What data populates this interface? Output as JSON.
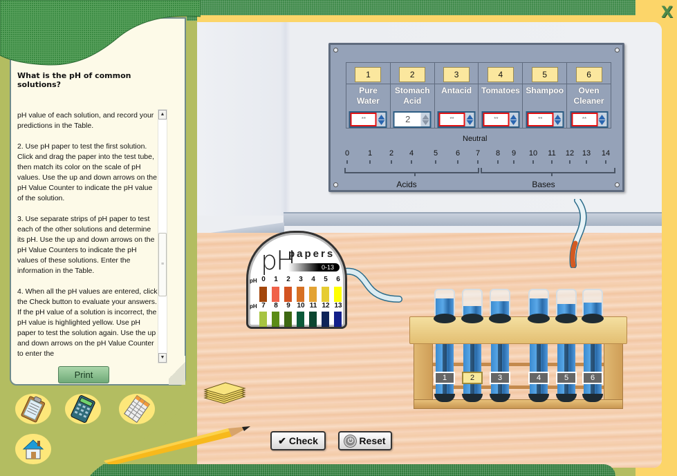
{
  "window": {
    "close_label": "X"
  },
  "left_panel": {
    "title": "What is the pH of common solutions?",
    "instructions": [
      "pH value of each solution, and record your predictions in the Table.",
      "2. Use pH paper to test the first solution. Click and drag the paper into the test tube, then match its color on the scale of pH values. Use the up and down arrows on the pH Value Counter to indicate the pH value of the solution.",
      "3. Use separate strips of pH paper to test each of the other solutions and determine its pH. Use the up and down arrows on the pH Value Counters to indicate the pH values of these solutions. Enter the information in the Table.",
      "4. When all the pH values are entered, click the Check button to evaluate your answers. If the pH value of a solution is incorrect, the pH value is highlighted yellow. Use pH paper to test the solution again. Use the up and down arrows on the pH Value Counter to enter the"
    ],
    "scroll_up_glyph": "▲",
    "scroll_down_glyph": "▼",
    "scroll_thumb_glyph": "≡",
    "print_label": "Print"
  },
  "tools": [
    {
      "name": "clipboard-icon",
      "label": "Clipboard"
    },
    {
      "name": "calculator-icon",
      "label": "Calculator"
    },
    {
      "name": "table-icon",
      "label": "Table"
    },
    {
      "name": "home-icon",
      "label": "Home"
    }
  ],
  "ph_panel": {
    "solutions": [
      {
        "number": "1",
        "name_line1": "Pure",
        "name_line2": "Water",
        "value": "**",
        "filled": false
      },
      {
        "number": "2",
        "name_line1": "Stomach",
        "name_line2": "Acid",
        "value": "2",
        "filled": true
      },
      {
        "number": "3",
        "name_line1": "Antacid",
        "name_line2": "",
        "value": "**",
        "filled": false
      },
      {
        "number": "4",
        "name_line1": "Tomatoes",
        "name_line2": "",
        "value": "**",
        "filled": false
      },
      {
        "number": "5",
        "name_line1": "Shampoo",
        "name_line2": "",
        "value": "**",
        "filled": false
      },
      {
        "number": "6",
        "name_line1": "Oven",
        "name_line2": "Cleaner",
        "value": "**",
        "filled": false
      }
    ],
    "neutral_label": "Neutral",
    "scale_ticks": [
      "0",
      "1",
      "2",
      "4",
      "5",
      "6",
      "7",
      "8",
      "9",
      "10",
      "11",
      "12",
      "13",
      "14"
    ],
    "acids_label": "Acids",
    "bases_label": "Bases"
  },
  "ph_papers": {
    "logo_ph": "pH",
    "logo_papers": "papers",
    "range": "0-13",
    "row_label": "pH",
    "row1": [
      {
        "value": "0",
        "color": "#a3470c"
      },
      {
        "value": "1",
        "color": "#f0624a"
      },
      {
        "value": "2",
        "color": "#d35422"
      },
      {
        "value": "3",
        "color": "#d77124"
      },
      {
        "value": "4",
        "color": "#e3a334"
      },
      {
        "value": "5",
        "color": "#e6cc32"
      },
      {
        "value": "6",
        "color": "#ffff00"
      }
    ],
    "row2": [
      {
        "value": "7",
        "color": "#a7c442"
      },
      {
        "value": "8",
        "color": "#5b8c16"
      },
      {
        "value": "9",
        "color": "#3e6812"
      },
      {
        "value": "10",
        "color": "#0b5a3a"
      },
      {
        "value": "11",
        "color": "#0c4630"
      },
      {
        "value": "12",
        "color": "#0d2458"
      },
      {
        "value": "13",
        "color": "#13208a"
      }
    ]
  },
  "tubes": [
    {
      "label": "1",
      "active": false
    },
    {
      "label": "2",
      "active": true
    },
    {
      "label": "3",
      "active": false
    },
    {
      "label": "4",
      "active": false
    },
    {
      "label": "5",
      "active": false
    },
    {
      "label": "6",
      "active": false
    }
  ],
  "actions": {
    "check_icon": "✔",
    "check_label": "Check",
    "reset_icon": "⏻",
    "reset_label": "Reset"
  },
  "colors": {
    "frame_green": "#b3bd61",
    "frame_yellow": "#fcd569",
    "panel_blue": "#95a2b8",
    "empty_input_border": "#e31212",
    "highlight_yellow": "#f8e99b"
  }
}
